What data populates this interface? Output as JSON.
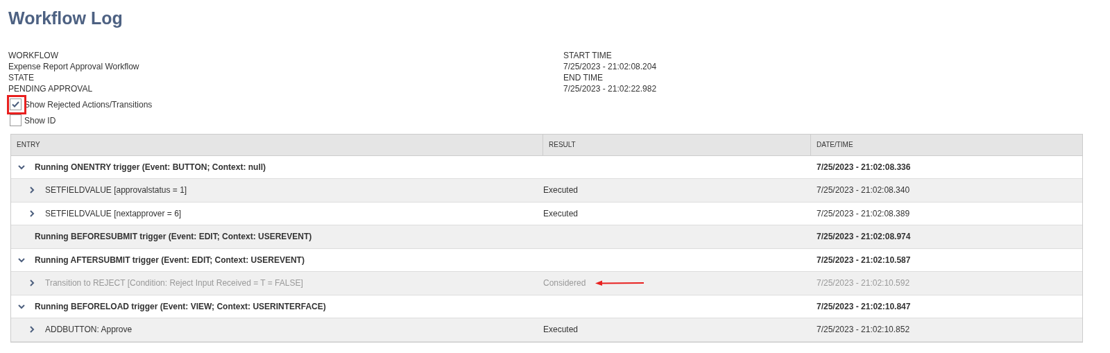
{
  "page_title": "Workflow Log",
  "details_left": [
    {
      "label": "WORKFLOW",
      "value": "Expense Report Approval Workflow"
    },
    {
      "label": "STATE",
      "value": "PENDING APPROVAL"
    }
  ],
  "details_right": [
    {
      "label": "START TIME",
      "value": "7/25/2023 - 21:02:08.204"
    },
    {
      "label": "END TIME",
      "value": "7/25/2023 - 21:02:22.982"
    }
  ],
  "options": [
    {
      "label": "Show Rejected Actions/Transitions",
      "checked": true,
      "highlighted": true
    },
    {
      "label": "Show ID",
      "checked": false,
      "highlighted": false
    }
  ],
  "table": {
    "columns": [
      "ENTRY",
      "RESULT",
      "DATE/TIME"
    ],
    "rows": [
      {
        "kind": "trigger",
        "expanded": true,
        "entry": "Running ONENTRY trigger (Event: BUTTON; Context: null)",
        "result": "",
        "datetime": "7/25/2023 - 21:02:08.336"
      },
      {
        "kind": "action",
        "rejected": false,
        "arrow": false,
        "entry": "SETFIELDVALUE [approvalstatus = 1]",
        "result": "Executed",
        "datetime": "7/25/2023 - 21:02:08.340"
      },
      {
        "kind": "action",
        "rejected": false,
        "arrow": false,
        "entry": "SETFIELDVALUE [nextapprover = 6]",
        "result": "Executed",
        "datetime": "7/25/2023 - 21:02:08.389"
      },
      {
        "kind": "trigger",
        "expanded": false,
        "entry": "Running BEFORESUBMIT trigger (Event: EDIT; Context: USEREVENT)",
        "result": "",
        "datetime": "7/25/2023 - 21:02:08.974"
      },
      {
        "kind": "trigger",
        "expanded": true,
        "entry": "Running AFTERSUBMIT trigger (Event: EDIT; Context: USEREVENT)",
        "result": "",
        "datetime": "7/25/2023 - 21:02:10.587"
      },
      {
        "kind": "action",
        "rejected": true,
        "arrow": true,
        "entry": "Transition to REJECT [Condition: Reject Input Received = T = FALSE]",
        "result": "Considered",
        "datetime": "7/25/2023 - 21:02:10.592"
      },
      {
        "kind": "trigger",
        "expanded": true,
        "entry": "Running BEFORELOAD trigger (Event: VIEW; Context: USERINTERFACE)",
        "result": "",
        "datetime": "7/25/2023 - 21:02:10.847"
      },
      {
        "kind": "action",
        "rejected": false,
        "arrow": false,
        "entry": "ADDBUTTON: Approve",
        "result": "Executed",
        "datetime": "7/25/2023 - 21:02:10.852"
      }
    ]
  }
}
